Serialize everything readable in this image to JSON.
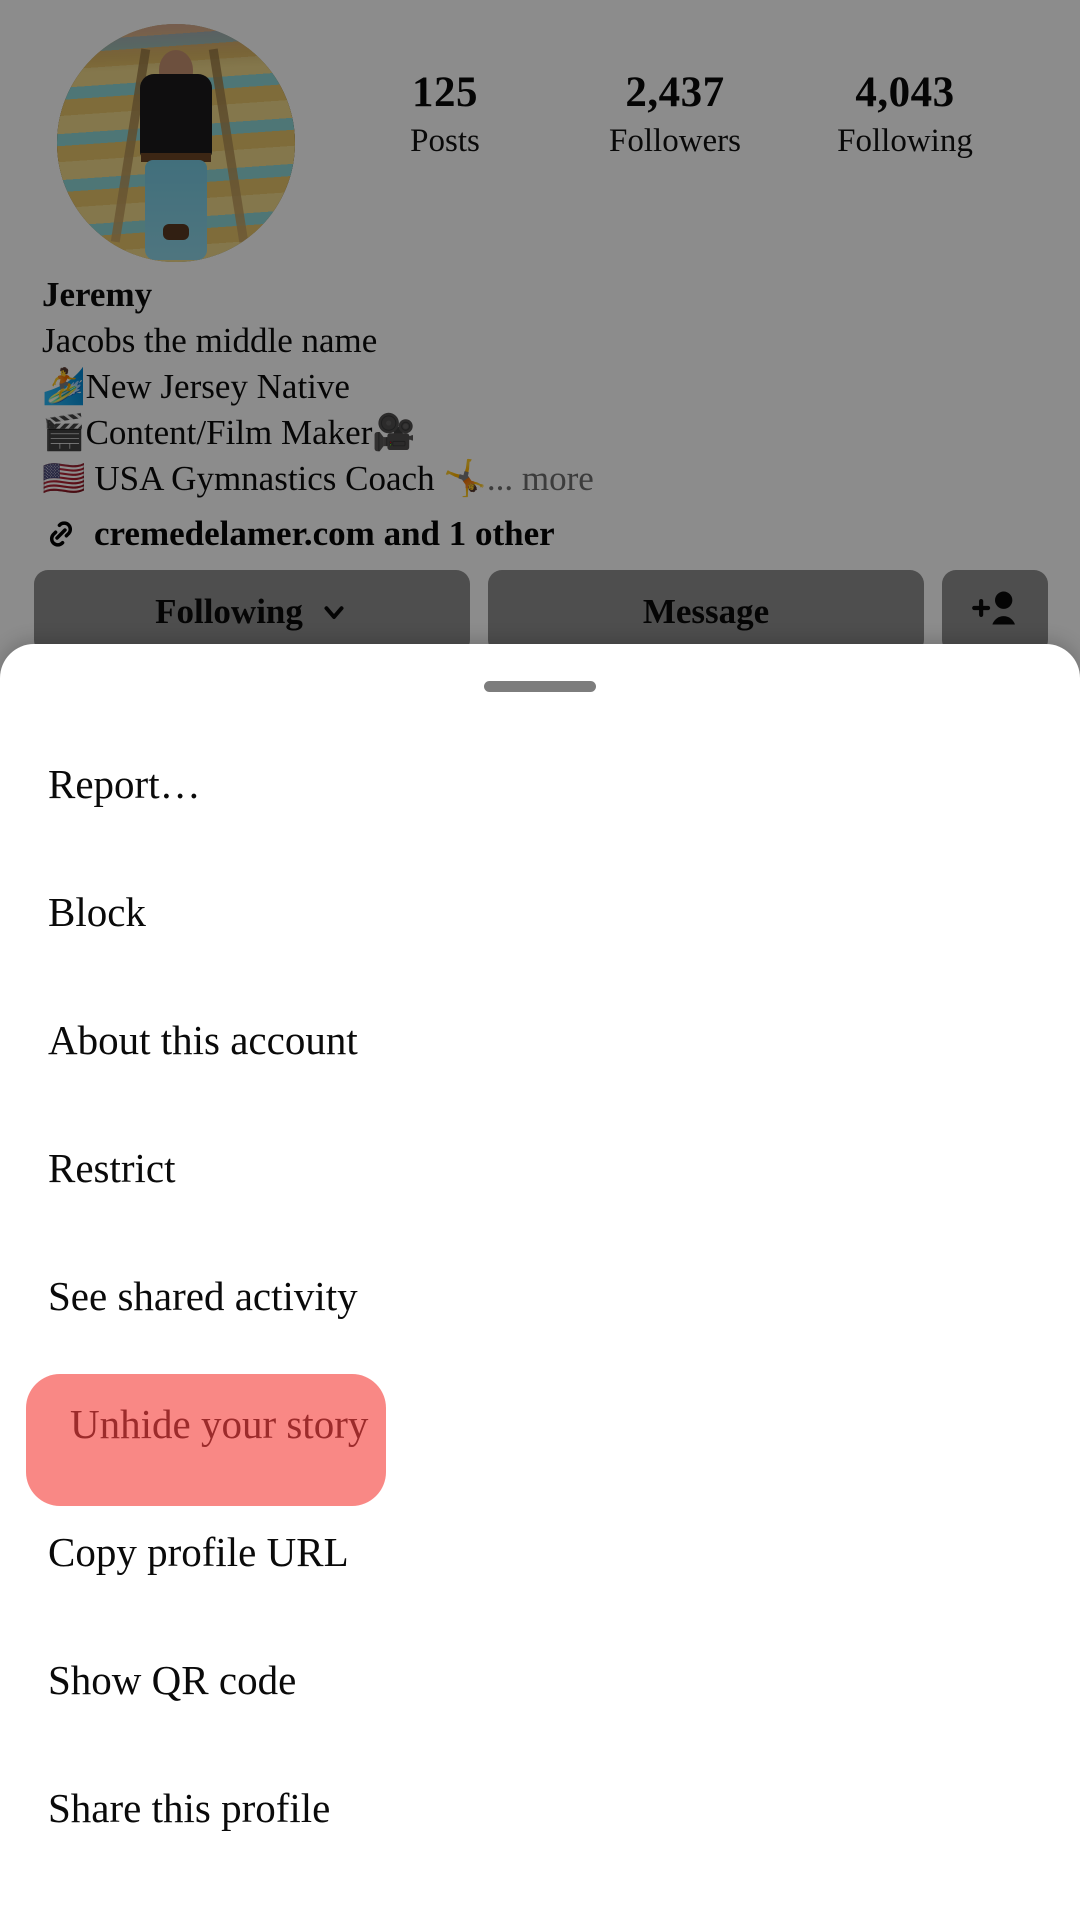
{
  "profile": {
    "avatar": {
      "icon": "profile-avatar",
      "alt": "person walking down colorful stairs"
    },
    "stats": [
      {
        "id": "posts",
        "value": "125",
        "label": "Posts"
      },
      {
        "id": "followers",
        "value": "2,437",
        "label": "Followers"
      },
      {
        "id": "following",
        "value": "4,043",
        "label": "Following"
      }
    ],
    "bio": {
      "name": "Jeremy",
      "lines": [
        "Jacobs the middle name",
        "🏄New Jersey Native",
        "🎬Content/Film Maker🎥"
      ],
      "last_line": "🇺🇸 USA Gymnastics Coach 🤸",
      "more_label": "... more",
      "link_icon": "link-icon",
      "link_text": "cremedelamer.com and 1 other"
    },
    "actions": [
      {
        "id": "following",
        "label": "Following",
        "icon": "chevron-down-icon"
      },
      {
        "id": "message",
        "label": "Message",
        "icon": ""
      },
      {
        "id": "add-user",
        "label": "",
        "icon": "add-person-icon"
      }
    ]
  },
  "sheet": {
    "handle": "drag-handle",
    "items": [
      {
        "id": "report",
        "label": "Report…",
        "highlighted": false
      },
      {
        "id": "block",
        "label": "Block",
        "highlighted": false
      },
      {
        "id": "about-this-account",
        "label": "About this account",
        "highlighted": false
      },
      {
        "id": "restrict",
        "label": "Restrict",
        "highlighted": false
      },
      {
        "id": "see-shared-activity",
        "label": "See shared activity",
        "highlighted": false
      },
      {
        "id": "unhide-your-story",
        "label": "Unhide your story",
        "highlighted": true
      },
      {
        "id": "copy-profile-url",
        "label": "Copy profile URL",
        "highlighted": false
      },
      {
        "id": "show-qr-code",
        "label": "Show QR code",
        "highlighted": false
      },
      {
        "id": "share-this-profile",
        "label": "Share this profile",
        "highlighted": false
      }
    ]
  },
  "colors": {
    "highlight_bg": "#F98885",
    "highlight_text": "#9C2B2B",
    "sheet_bg": "#FFFFFF",
    "dim_overlay": "rgba(0,0,0,0.45)",
    "button_bg": "#8E8E8E"
  }
}
